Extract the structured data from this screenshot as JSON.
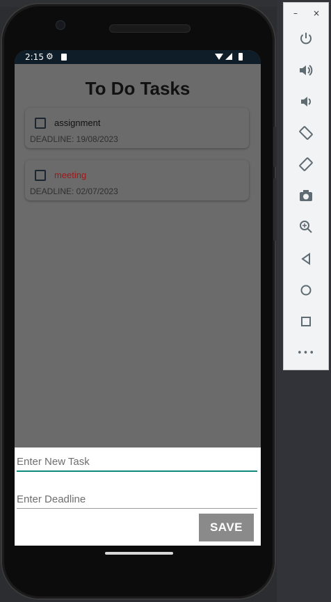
{
  "status_bar": {
    "time": "2:15"
  },
  "app": {
    "title": "To Do Tasks",
    "tasks": [
      {
        "name": "assignment",
        "deadline": "DEADLINE: 19/08/2023",
        "name_color": "#111111"
      },
      {
        "name": "meeting",
        "deadline": "DEADLINE: 02/07/2023",
        "name_color": "#a01818"
      }
    ],
    "input": {
      "task_placeholder": "Enter New Task",
      "deadline_placeholder": "Enter Deadline",
      "save_label": "SAVE"
    }
  },
  "emulator_toolbar": {
    "minimize": "–",
    "close": "×",
    "buttons": [
      "power-icon",
      "volume-up-icon",
      "volume-down-icon",
      "rotate-left-icon",
      "rotate-right-icon",
      "camera-icon",
      "zoom-icon",
      "back-icon",
      "home-icon",
      "overview-icon",
      "more-icon"
    ],
    "more_label": "•••"
  },
  "colors": {
    "accent": "#0d8a7a",
    "save_bg": "#8a8a8a",
    "scrim": "#6b6b6b"
  }
}
